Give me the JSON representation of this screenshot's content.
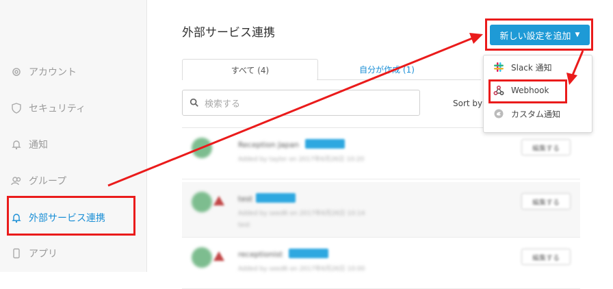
{
  "sidebar": {
    "items": [
      {
        "label": "アカウント",
        "icon": "gear-icon"
      },
      {
        "label": "セキュリティ",
        "icon": "shield-icon"
      },
      {
        "label": "通知",
        "icon": "bell-icon"
      },
      {
        "label": "グループ",
        "icon": "users-icon"
      },
      {
        "label": "外部サービス連携",
        "icon": "bell-icon",
        "active": true
      },
      {
        "label": "アプリ",
        "icon": "phone-icon"
      }
    ]
  },
  "main": {
    "title": "外部サービス連携",
    "tabs": [
      {
        "label": "すべて (4)",
        "active": true
      },
      {
        "label": "自分が作成 (1)"
      }
    ],
    "search": {
      "placeholder": "検索する"
    },
    "sort_label": "Sort by",
    "rows": [
      {
        "name": "Reception Japan",
        "meta": "Added by taylor on 2017年6月26日 10:20",
        "action": "編集する"
      },
      {
        "name": "test",
        "meta": "Added by seed6 on 2017年6月26日 10:14",
        "extra": "test",
        "action": "編集する"
      },
      {
        "name": "receptionist",
        "meta": "Added by seed6 on 2017年6月26日 10:00",
        "action": "編集する"
      }
    ]
  },
  "add_menu": {
    "button_label": "新しい設定を追加",
    "items": [
      {
        "label": "Slack 通知",
        "icon": "slack-icon"
      },
      {
        "label": "Webhook",
        "icon": "webhook-icon"
      },
      {
        "label": "カスタム通知",
        "icon": "custom-notification-icon"
      }
    ]
  },
  "colors": {
    "accent": "#1e9ad6",
    "highlight": "#ea1b1b",
    "sidebar_bg": "#f7f7f7"
  }
}
